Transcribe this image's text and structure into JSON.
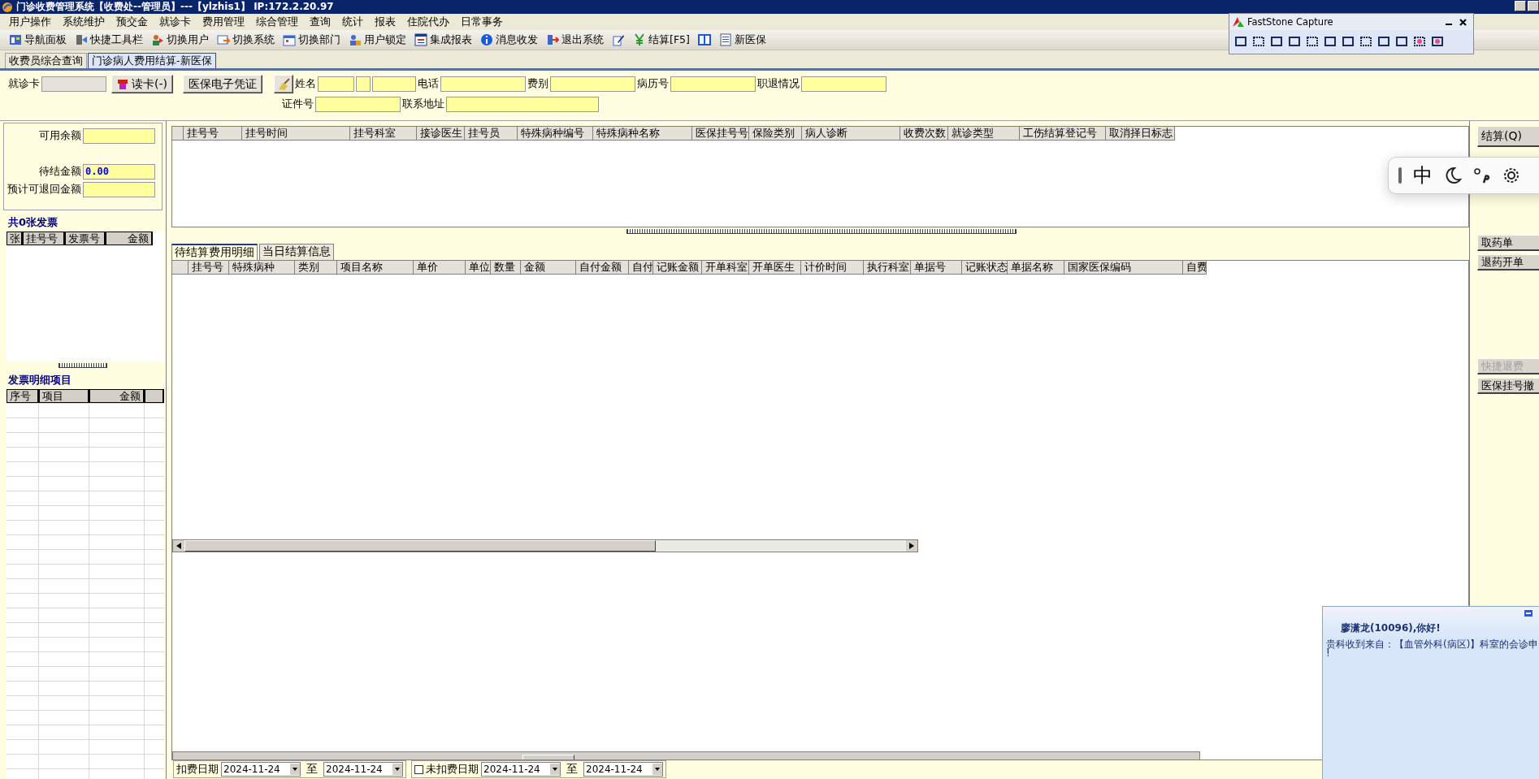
{
  "window": {
    "title": "门诊收费管理系统【收费处--管理员】---【ylzhis1】 IP:172.2.20.97"
  },
  "menu": [
    "用户操作",
    "系统维护",
    "预交金",
    "就诊卡",
    "费用管理",
    "综合管理",
    "查询",
    "统计",
    "报表",
    "住院代办",
    "日常事务"
  ],
  "toolbar": [
    {
      "kind": "labeled",
      "label": "导航面板"
    },
    {
      "kind": "labeled",
      "label": "快捷工具栏"
    },
    {
      "kind": "labeled",
      "label": "切换用户"
    },
    {
      "kind": "labeled",
      "label": "切换系统"
    },
    {
      "kind": "labeled",
      "label": "切换部门"
    },
    {
      "kind": "labeled",
      "label": "用户锁定"
    },
    {
      "kind": "labeled",
      "label": "集成报表"
    },
    {
      "kind": "labeled",
      "label": "消息收发"
    },
    {
      "kind": "labeled",
      "label": "退出系统"
    },
    {
      "kind": "icon_only"
    },
    {
      "kind": "labeled",
      "label": "结算[F5]"
    },
    {
      "kind": "icon_only"
    },
    {
      "kind": "labeled",
      "label": "新医保"
    }
  ],
  "tabs": [
    {
      "label": "收费员综合查询",
      "selected": false
    },
    {
      "label": "门诊病人费用结算-新医保",
      "selected": true
    }
  ],
  "patient_form": {
    "card_label": "就诊卡",
    "read_card_button": "读卡(-)",
    "e_voucher_button": "医保电子凭证",
    "row_1": [
      {
        "label": "姓名",
        "kind": "name"
      },
      {
        "label": "电话",
        "kind": "single"
      },
      {
        "label": "费别",
        "kind": "single"
      },
      {
        "label": "病历号",
        "kind": "single"
      },
      {
        "label": "职退情况",
        "kind": "single"
      }
    ],
    "row_2": [
      {
        "label": "证件号",
        "kind": "single"
      },
      {
        "label": "联系地址",
        "kind": "wide"
      }
    ]
  },
  "balances": [
    {
      "label": "可用余额"
    },
    {
      "label": "待结金额",
      "value": "0.00"
    },
    {
      "label": "预计可退回金额"
    }
  ],
  "invoices": {
    "title": "共0张发票",
    "columns": [
      "张",
      "挂号号",
      "发票号",
      "金额"
    ]
  },
  "invoice_items": {
    "title": "发票明细项目",
    "columns": [
      "序号",
      "项目",
      "金额"
    ]
  },
  "registrations": {
    "columns": [
      "挂号号",
      "挂号时间",
      "挂号科室",
      "接诊医生",
      "挂号员",
      "特殊病种编号",
      "特殊病种名称",
      "医保挂号号",
      "保险类别",
      "病人诊断",
      "收费次数",
      "就诊类型",
      "工伤结算登记号",
      "取消择日标志"
    ]
  },
  "detail_tabs": [
    {
      "label": "待结算费用明细",
      "selected": true
    },
    {
      "label": "当日结算信息",
      "selected": false
    }
  ],
  "details": {
    "columns": [
      "挂号号",
      "特殊病种",
      "类别",
      "项目名称",
      "单价",
      "单位",
      "数量",
      "金额",
      "自付金额",
      "自付",
      "记账金额",
      "开单科室",
      "开单医生",
      "计价时间",
      "执行科室",
      "单据号",
      "记账状态",
      "单据名称",
      "国家医保编码",
      "自费"
    ]
  },
  "date_filters": [
    {
      "label": "扣费日期",
      "from": "2024-11-24",
      "to_label": "至",
      "to": "2024-11-24"
    },
    {
      "label": "未扣费日期",
      "checked": false,
      "from": "2024-11-24",
      "to_label": "至",
      "to": "2024-11-24"
    }
  ],
  "action_groups": [
    [
      {
        "label": "结算(Q)",
        "disabled": false
      }
    ],
    [
      {
        "label": "取药单",
        "disabled": false
      },
      {
        "label": "退药开单",
        "disabled": false
      }
    ],
    [
      {
        "label": "快捷退费",
        "disabled": true
      },
      {
        "label": "医保挂号撤",
        "disabled": false
      }
    ]
  ],
  "capture_tool": {
    "title": "FastStone Capture"
  },
  "ime_bar": {
    "mode": "中"
  },
  "notification": {
    "greeting": "廖潇龙(10096),你好!",
    "lines": [
      "贵科收到来自：【血管外科(病区)】科室的会诊申",
      "!"
    ]
  }
}
